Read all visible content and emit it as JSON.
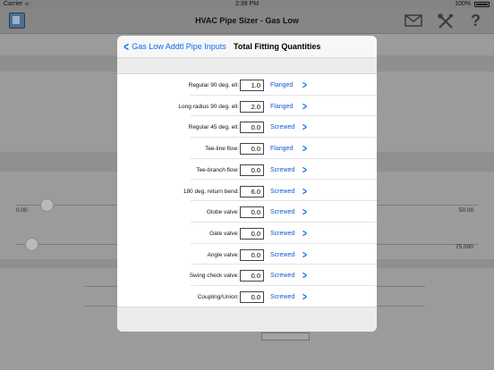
{
  "status_bar": {
    "carrier": "Carrier",
    "time": "2:39 PM",
    "battery": "100%"
  },
  "app": {
    "title": "HVAC Pipe Sizer - Gas Low",
    "icons": [
      "app-logo-icon",
      "mail-icon",
      "tools-icon",
      "help-icon"
    ]
  },
  "background": {
    "slider1": {
      "min_label": "0.00",
      "max_label": "50.00"
    },
    "slider2": {
      "max_label": "75.000"
    }
  },
  "sheet": {
    "back_label": "Gas Low Addtl Pipe Inputs",
    "title": "Total Fitting Quantities",
    "rows": [
      {
        "label": "Regular 90 deg. ell:",
        "value": "1.0",
        "connection": "Flanged"
      },
      {
        "label": "Long radius 90 deg. ell:",
        "value": "2.0",
        "connection": "Flanged"
      },
      {
        "label": "Regular 45 deg. ell:",
        "value": "0.0",
        "connection": "Screwed"
      },
      {
        "label": "Tee-line flow:",
        "value": "0.0",
        "connection": "Flanged"
      },
      {
        "label": "Tee-branch flow:",
        "value": "0.0",
        "connection": "Screwed"
      },
      {
        "label": "180 deg. return bend:",
        "value": "6.0",
        "connection": "Screwed"
      },
      {
        "label": "Globe valve:",
        "value": "0.0",
        "connection": "Screwed"
      },
      {
        "label": "Gate valve:",
        "value": "0.0",
        "connection": "Screwed"
      },
      {
        "label": "Angle valve:",
        "value": "0.0",
        "connection": "Screwed"
      },
      {
        "label": "Swing check valve:",
        "value": "0.0",
        "connection": "Screwed"
      },
      {
        "label": "Coupling/Union:",
        "value": "0.0",
        "connection": "Screwed"
      }
    ]
  },
  "colors": {
    "accent": "#0a6cf0",
    "dim_overlay": "#9b9b9b"
  }
}
